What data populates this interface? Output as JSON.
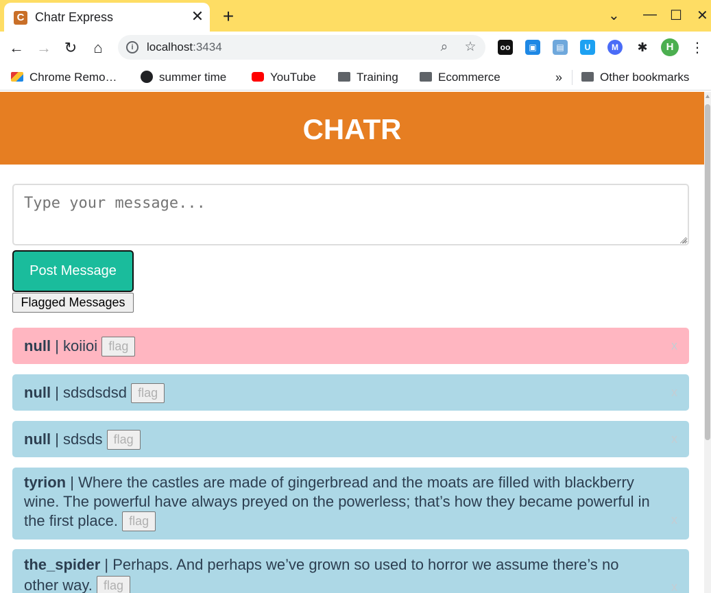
{
  "browser": {
    "tab_title": "Chatr Express",
    "tab_favicon": "C",
    "url_host": "localhost",
    "url_port": ":3434",
    "profile_initial": "H",
    "bookmarks": [
      {
        "label": "Chrome Remo…",
        "icon": "chrome-remote-icon"
      },
      {
        "label": "summer time",
        "icon": "globe-icon"
      },
      {
        "label": "YouTube",
        "icon": "youtube-icon"
      },
      {
        "label": "Training",
        "icon": "folder-icon"
      },
      {
        "label": "Ecommerce",
        "icon": "folder-icon"
      }
    ],
    "bookmarks_overflow": "»",
    "other_bookmarks": "Other bookmarks"
  },
  "app": {
    "title": "CHATR",
    "input_placeholder": "Type your message...",
    "post_button": "Post Message",
    "flagged_button": "Flagged Messages",
    "flag_label": "flag",
    "close_label": "x"
  },
  "messages": [
    {
      "user": "null",
      "text": " | koiioi",
      "flagged": true
    },
    {
      "user": "null",
      "text": " | sdsdsdsd",
      "flagged": false
    },
    {
      "user": "null",
      "text": " | sdsds",
      "flagged": false
    },
    {
      "user": "tyrion",
      "text": " | Where the castles are made of gingerbread and the moats are filled with blackberry wine. The powerful have always preyed on the powerless; that’s how they became powerful in the first place.",
      "flagged": false
    },
    {
      "user": "the_spider",
      "text": " | Perhaps. And perhaps we’ve grown so used to horror we assume there’s no other way.",
      "flagged": false
    }
  ],
  "colors": {
    "header": "#e67e22",
    "post_button": "#1abc9c",
    "flagged_message": "#ffb6c1",
    "normal_message": "#add8e6",
    "tab_strip": "#fedd64"
  }
}
